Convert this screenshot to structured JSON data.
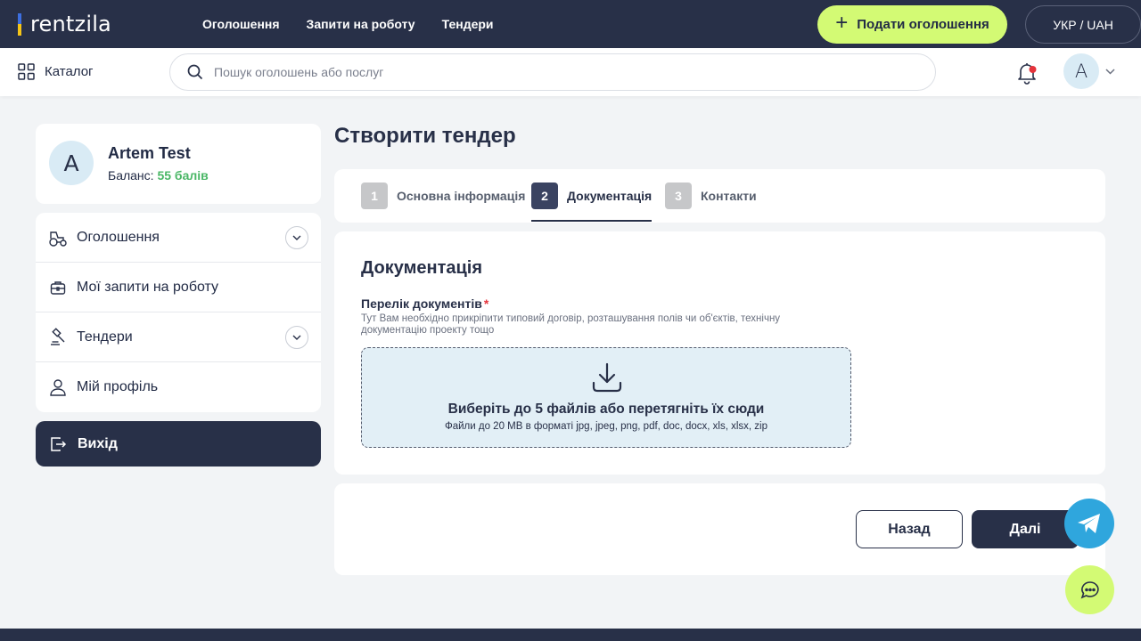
{
  "header": {
    "logo_text": "rentzila",
    "nav": [
      "Оголошення",
      "Запити на роботу",
      "Тендери"
    ],
    "post_button": "Подати оголошення",
    "lang_currency": "УКР / UAH"
  },
  "subheader": {
    "catalog_label": "Каталог",
    "search_placeholder": "Пошук оголошень або послуг",
    "avatar_letter": "A"
  },
  "profile": {
    "avatar_letter": "A",
    "name": "Artem Test",
    "balance_label": "Баланс:",
    "balance_value": "55 балів"
  },
  "sidebar": {
    "items": [
      {
        "label": "Оголошення",
        "expandable": true
      },
      {
        "label": "Мої запити на роботу",
        "expandable": false
      },
      {
        "label": "Тендери",
        "expandable": true
      },
      {
        "label": "Мій профіль",
        "expandable": false
      }
    ],
    "logout_label": "Вихід"
  },
  "main": {
    "page_title": "Створити тендер",
    "steps": [
      {
        "num": "1",
        "label": "Основна інформація",
        "active": false
      },
      {
        "num": "2",
        "label": "Документація",
        "active": true
      },
      {
        "num": "3",
        "label": "Контакти",
        "active": false
      }
    ],
    "docs": {
      "title": "Документація",
      "field_label": "Перелік документів",
      "required_mark": "*",
      "hint": "Тут Вам необхідно прикріпити типовий договір, розташування полів чи об'єктів, технічну документацію проекту тощо",
      "dropzone_main": "Виберіть до 5 файлів або перетягніть їх сюди",
      "dropzone_sub": "Файли до 20 MB в форматі jpg, jpeg, png, pdf, doc, docx, xls, xlsx, zip"
    },
    "buttons": {
      "back": "Назад",
      "next": "Далі"
    }
  },
  "colors": {
    "primary_dark": "#283048",
    "accent_green": "#d3fa74",
    "balance_green": "#4ab766",
    "required_red": "#e5343c",
    "telegram_blue": "#2fa6dd"
  }
}
